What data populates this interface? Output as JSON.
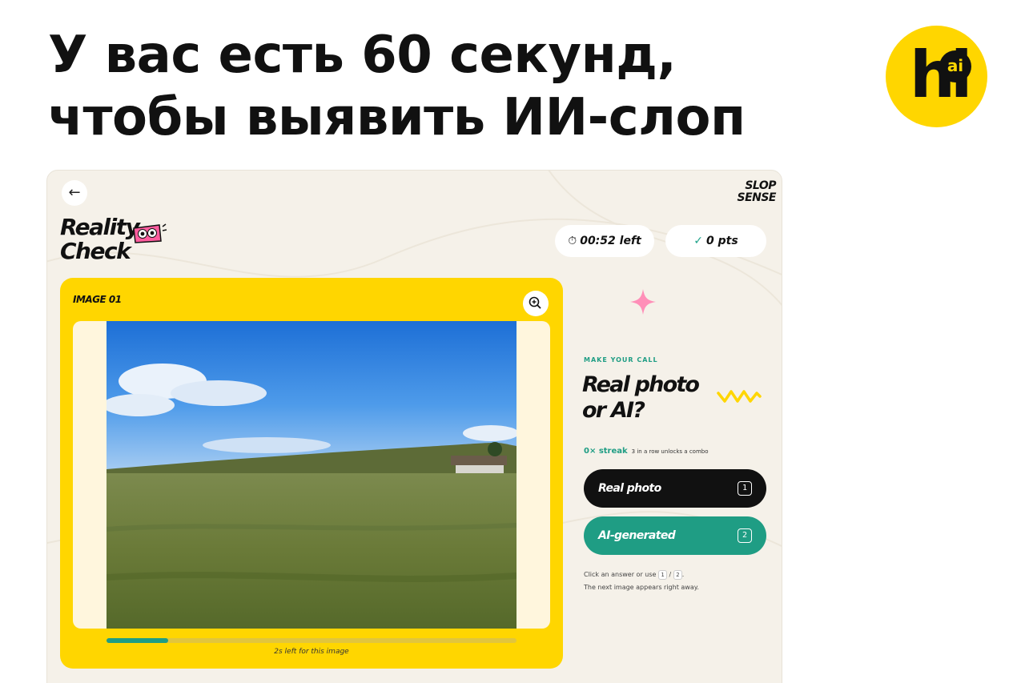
{
  "headline": {
    "line1": "У вас есть 60 секунд,",
    "line2": "чтобы выявить ИИ-слоп"
  },
  "brand_logo": {
    "main": "hi",
    "badge": "ai",
    "color": "#FFD600"
  },
  "app": {
    "back_icon": "arrow-left-icon",
    "slop_logo": [
      "SLOP",
      "SENSE"
    ],
    "reality_logo": [
      "Reality",
      "Check"
    ],
    "timer": {
      "icon": "stopwatch-icon",
      "label": "00:52 left"
    },
    "score": {
      "icon": "check-circle-icon",
      "label": "0 pts"
    },
    "image_card": {
      "title": "IMAGE 01",
      "zoom_icon": "zoom-in-icon",
      "progress": 0.15,
      "progress_text": "2s left for this image"
    },
    "panel": {
      "eyebrow": "MAKE YOUR CALL",
      "question_line1": "Real photo",
      "question_line2": "or AI?",
      "streak_count": "0× streak",
      "streak_note": "3 in a row unlocks a combo",
      "answers": [
        {
          "label": "Real photo",
          "key": "1"
        },
        {
          "label": "AI-generated",
          "key": "2"
        }
      ],
      "hint_prefix": "Click an answer or use",
      "hint_key1": "1",
      "hint_sep": "/",
      "hint_key2": "2",
      "hint_suffix": ".",
      "hint_line2": "The next image appears right away."
    },
    "colors": {
      "accent_yellow": "#FFD600",
      "accent_green": "#1F9D84",
      "accent_pink": "#FF5C9E",
      "background": "#F5F1E9"
    }
  }
}
